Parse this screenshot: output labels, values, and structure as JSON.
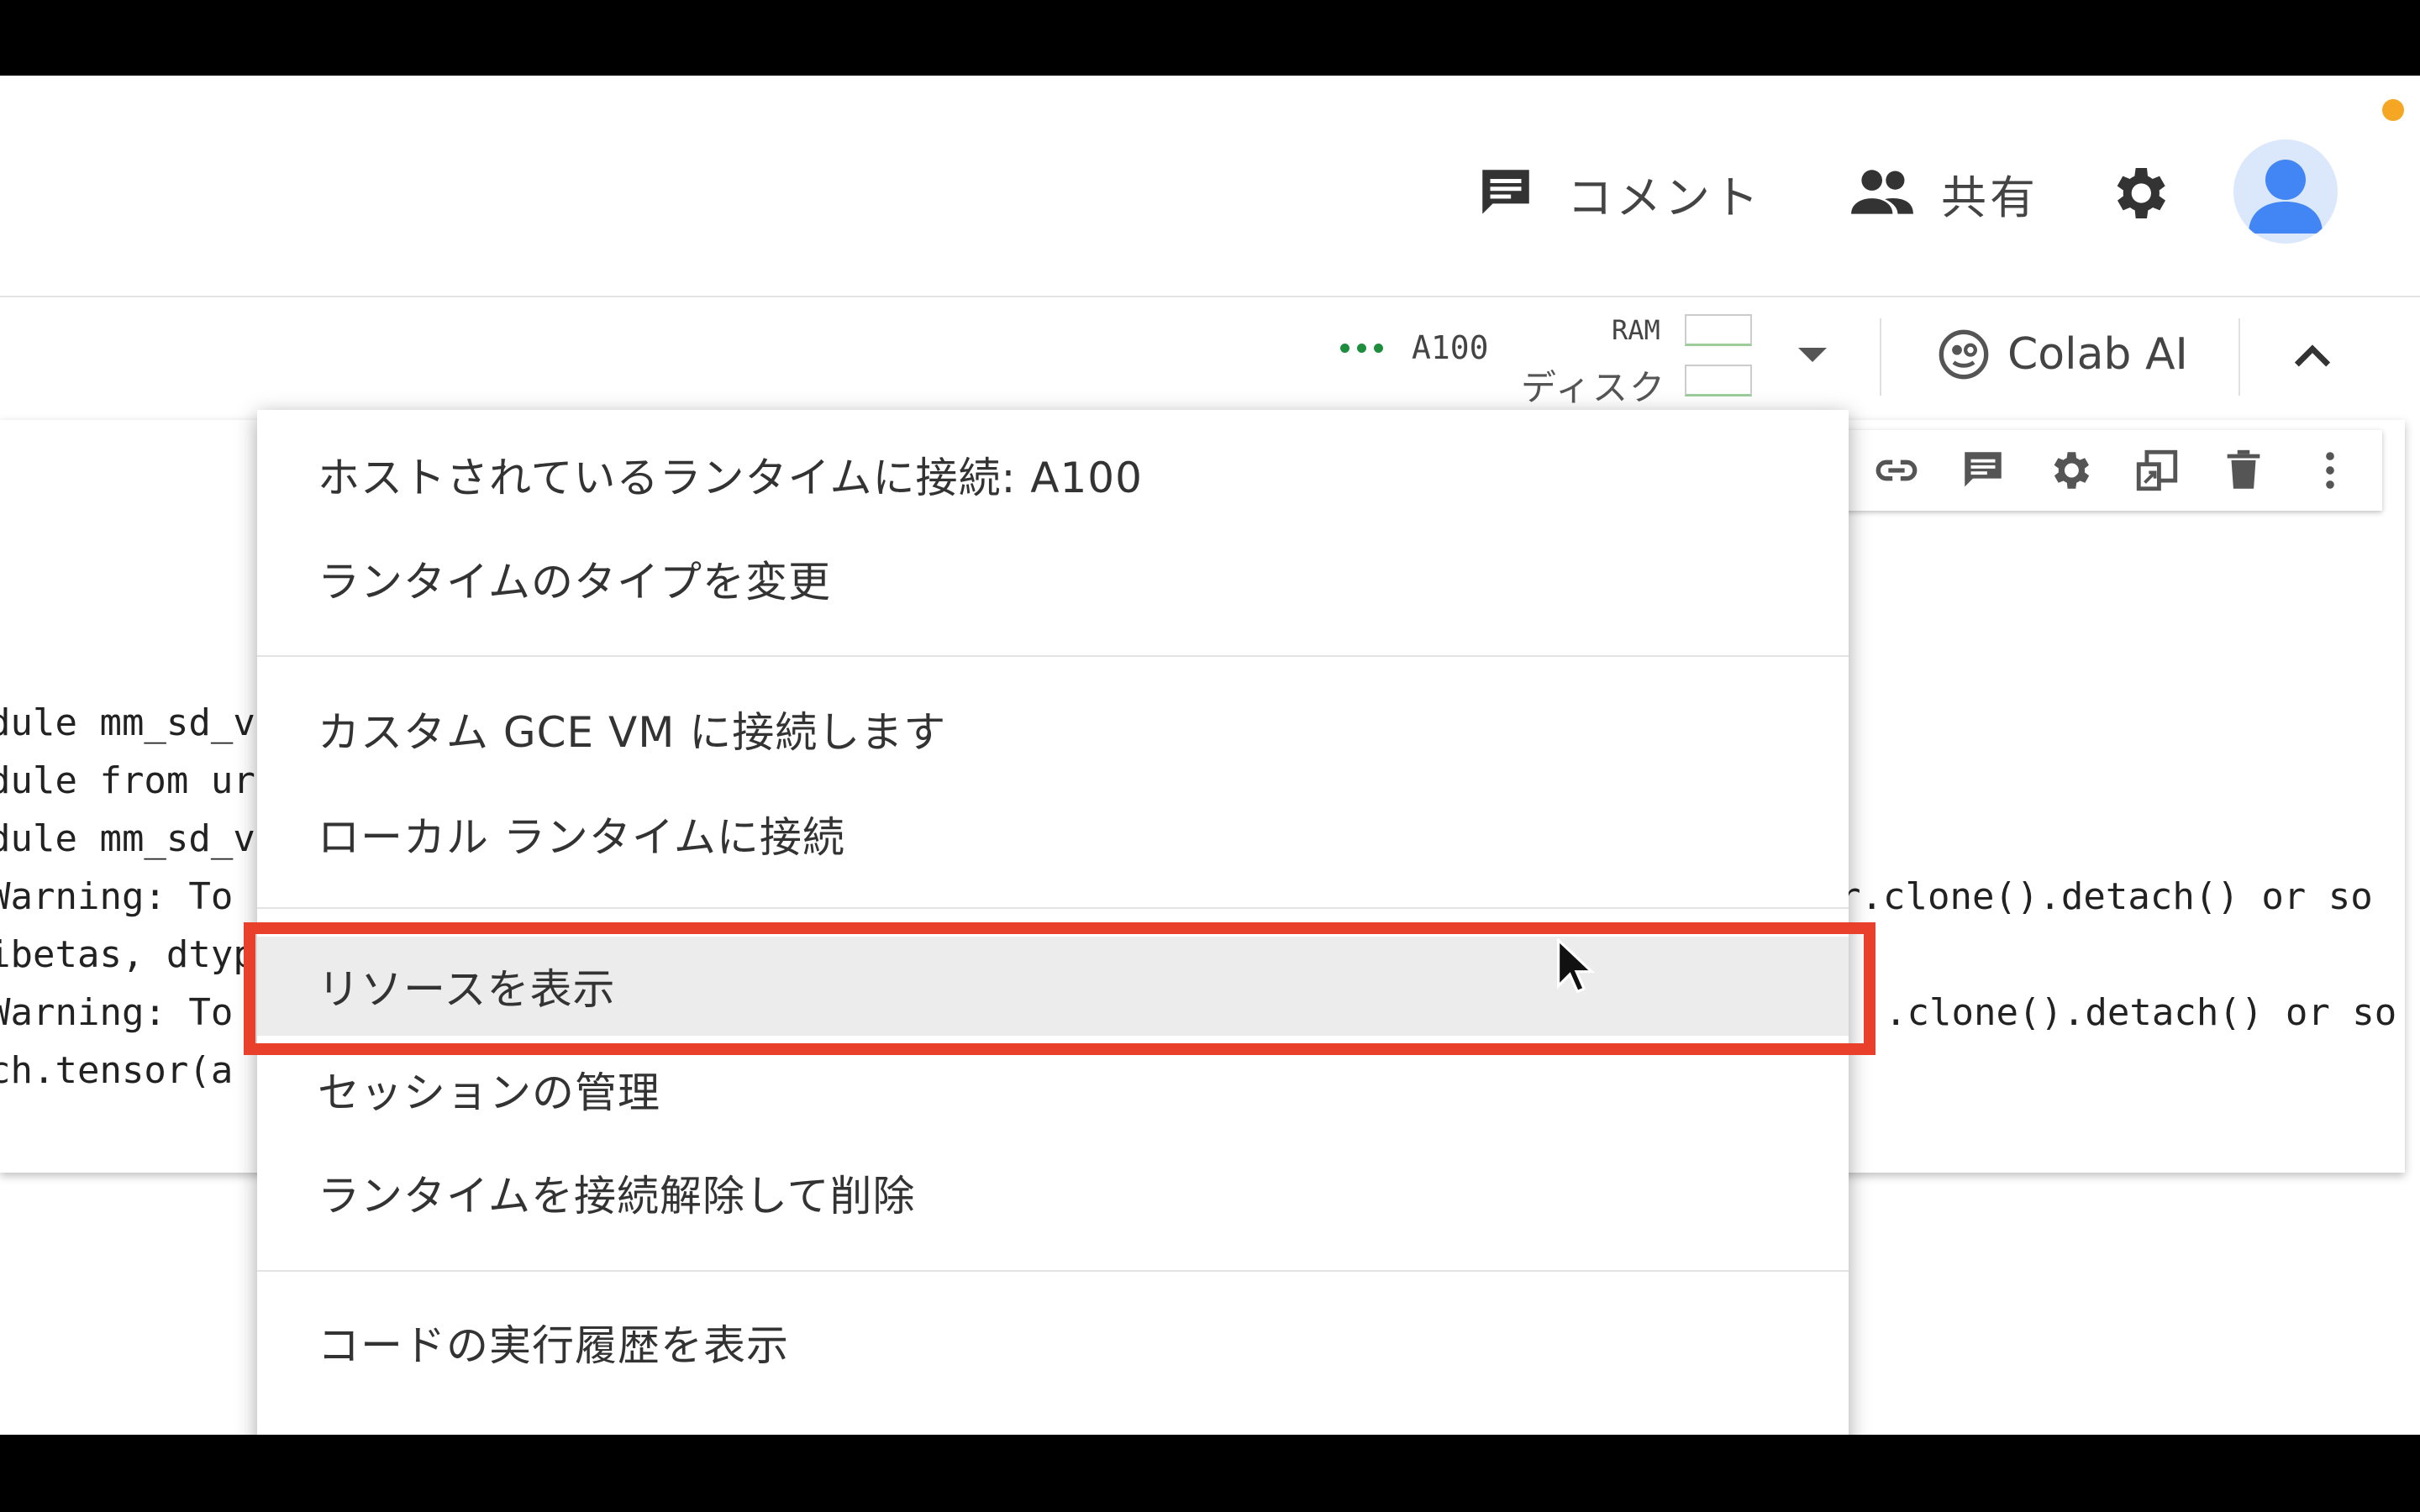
{
  "header": {
    "comment_label": "コメント",
    "share_label": "共有"
  },
  "runtime": {
    "gpu": "A100",
    "ram_label": "RAM",
    "disk_label": "ディスク"
  },
  "colab_ai": {
    "label": "Colab AI"
  },
  "code_output": {
    "left_lines": [
      "dule mm_sd_v",
      "dule from ur",
      "dule mm_sd_v",
      "Warning: To",
      "ibetas, dtyp",
      "Warning: To",
      "ch.tensor(a"
    ],
    "right_lines": [
      "r.clone().detach() or so",
      ".clone().detach() or so"
    ]
  },
  "menu": {
    "items": [
      "ホストされているランタイムに接続: A100",
      "ランタイムのタイプを変更",
      "カスタム GCE VM に接続します",
      "ローカル ランタイムに接続",
      "リソースを表示",
      "セッションの管理",
      "ランタイムを接続解除して削除",
      "コードの実行履歴を表示"
    ],
    "highlighted_index": 4
  },
  "colors": {
    "highlight_border": "#e8402a",
    "status_green": "#1e8e3e",
    "avatar_blue": "#4285f4",
    "notification_dot": "#f5a623"
  },
  "icons": [
    "comment-icon",
    "people-icon",
    "gear-icon",
    "avatar-icon",
    "colab-ai-icon",
    "chevron-up-icon",
    "link-icon",
    "comment-icon",
    "gear-icon",
    "mirror-cell-icon",
    "trash-icon",
    "more-vert-icon",
    "cursor-arrow-icon"
  ]
}
